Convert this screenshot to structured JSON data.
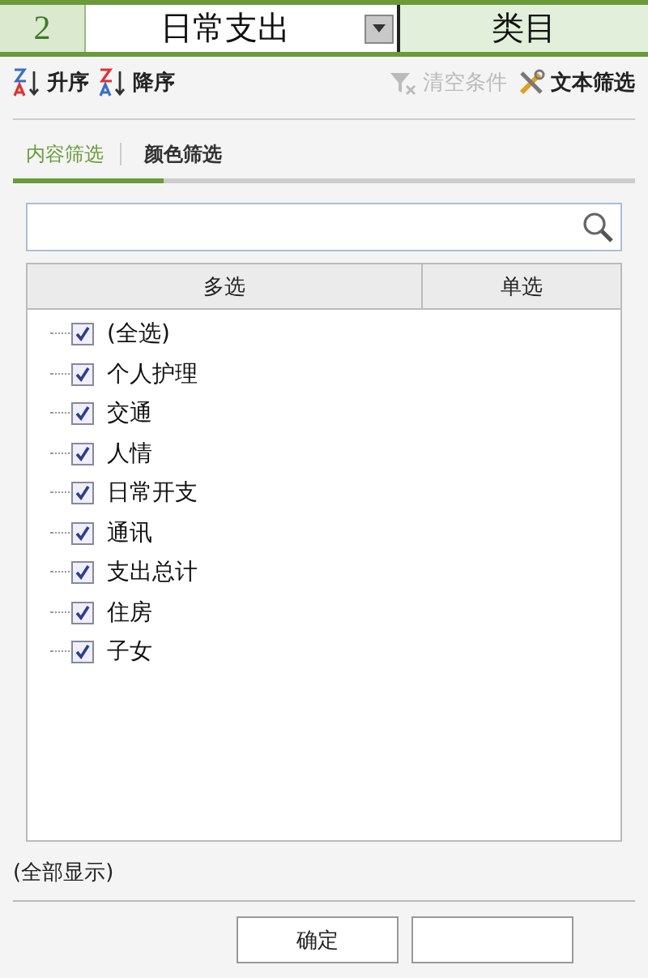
{
  "sheet_header": {
    "row_number": "2",
    "cell": "日常支出",
    "next_cell": "类目"
  },
  "toolbar": [
    {
      "kind": "sort-asc",
      "label": "升序",
      "disabled": false
    },
    {
      "kind": "sort-desc",
      "label": "降序",
      "disabled": false
    },
    {
      "kind": "clear",
      "label": "清空条件",
      "disabled": true
    },
    {
      "kind": "text-filter",
      "label": "文本筛选",
      "disabled": false
    }
  ],
  "tabs": [
    {
      "label": "内容筛选",
      "selected": true
    },
    {
      "label": "颜色筛选",
      "selected": false
    }
  ],
  "list": {
    "columns": [
      "多选",
      "单选"
    ],
    "items": [
      {
        "label": "(全选)",
        "checked": true
      },
      {
        "label": "个人护理",
        "checked": true
      },
      {
        "label": "交通",
        "checked": true
      },
      {
        "label": "人情",
        "checked": true
      },
      {
        "label": "日常开支",
        "checked": true
      },
      {
        "label": "通讯",
        "checked": true
      },
      {
        "label": "支出总计",
        "checked": true
      },
      {
        "label": "住房",
        "checked": true
      },
      {
        "label": "子女",
        "checked": true
      }
    ]
  },
  "status": "(全部显示)",
  "buttons": [
    "确定"
  ]
}
